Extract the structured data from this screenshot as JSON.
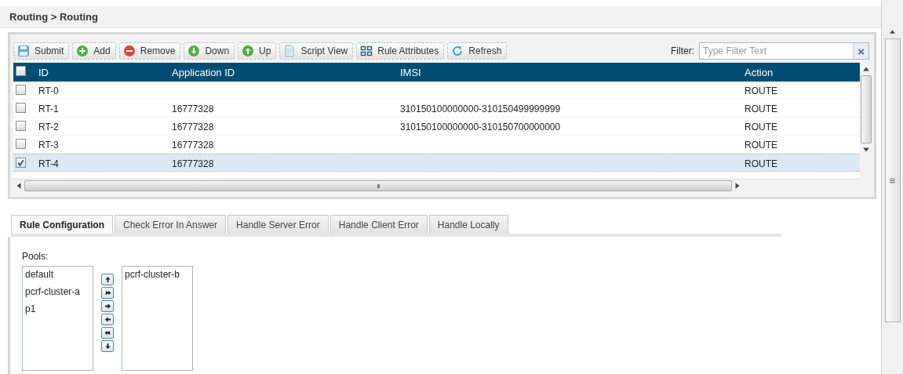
{
  "breadcrumb": "Routing > Routing",
  "toolbar": {
    "buttons": [
      {
        "label": "Submit",
        "kind": "save"
      },
      {
        "label": "Add",
        "kind": "add"
      },
      {
        "label": "Remove",
        "kind": "remove"
      },
      {
        "label": "Down",
        "kind": "down"
      },
      {
        "label": "Up",
        "kind": "up"
      },
      {
        "label": "Script View",
        "kind": "script"
      },
      {
        "label": "Rule Attributes",
        "kind": "attributes"
      },
      {
        "label": "Refresh",
        "kind": "refresh"
      }
    ],
    "filter": {
      "label": "Filter:",
      "placeholder": "Type Filter Text",
      "clear": "×"
    }
  },
  "table": {
    "header_checked": false,
    "columns": [
      "ID",
      "Application ID",
      "IMSI",
      "Action"
    ],
    "rows": [
      {
        "checked": false,
        "selected": false,
        "cells": [
          "RT-0",
          "",
          "",
          "ROUTE"
        ]
      },
      {
        "checked": false,
        "selected": false,
        "cells": [
          "RT-1",
          "16777328",
          "310150100000000-310150499999999",
          "ROUTE"
        ]
      },
      {
        "checked": false,
        "selected": false,
        "cells": [
          "RT-2",
          "16777328",
          "310150100000000-310150700000000",
          "ROUTE"
        ]
      },
      {
        "checked": false,
        "selected": false,
        "cells": [
          "RT-3",
          "16777328",
          "",
          "ROUTE"
        ]
      },
      {
        "checked": true,
        "selected": true,
        "cells": [
          "RT-4",
          "16777328",
          "",
          "ROUTE"
        ]
      }
    ],
    "hscroll_grip": "III"
  },
  "tabs": [
    {
      "label": "Rule Configuration",
      "selected": true
    },
    {
      "label": "Check Error In Answer",
      "selected": false
    },
    {
      "label": "Handle Server Error",
      "selected": false
    },
    {
      "label": "Handle Client Error",
      "selected": false
    },
    {
      "label": "Handle Locally",
      "selected": false
    }
  ],
  "pools": {
    "label": "Pools:",
    "available": [
      "default",
      "pcrf-cluster-a",
      "p1"
    ],
    "chosen": [
      "pcrf-cluster-b"
    ]
  }
}
